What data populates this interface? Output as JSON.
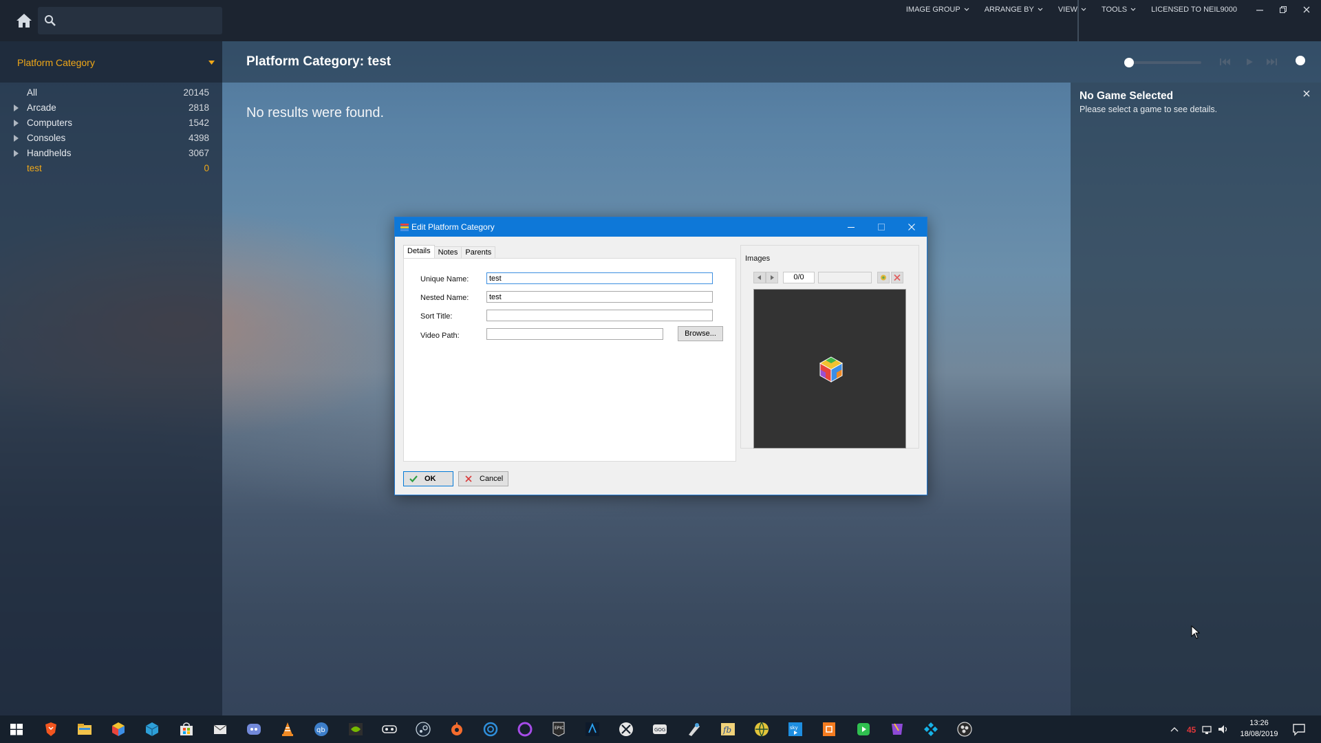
{
  "search": {
    "placeholder": ""
  },
  "top_menu": {
    "image_group": "IMAGE GROUP",
    "arrange_by": "ARRANGE BY",
    "view": "VIEW",
    "tools": "TOOLS",
    "license": "LICENSED TO NEIL9000"
  },
  "sidebar": {
    "title": "Platform Category",
    "items": [
      {
        "label": "All",
        "count": "20145",
        "expandable": false
      },
      {
        "label": "Arcade",
        "count": "2818",
        "expandable": true
      },
      {
        "label": "Computers",
        "count": "1542",
        "expandable": true
      },
      {
        "label": "Consoles",
        "count": "4398",
        "expandable": true
      },
      {
        "label": "Handhelds",
        "count": "3067",
        "expandable": true
      },
      {
        "label": "test",
        "count": "0",
        "expandable": false,
        "active": true
      }
    ]
  },
  "main": {
    "title": "Platform Category: test",
    "empty_message": "No results were found."
  },
  "details_panel": {
    "title": "No Game Selected",
    "subtitle": "Please select a game to see details."
  },
  "dialog": {
    "title": "Edit Platform Category",
    "tabs": [
      {
        "label": "Details",
        "active": true
      },
      {
        "label": "Notes",
        "active": false
      },
      {
        "label": "Parents",
        "active": false
      }
    ],
    "fields": {
      "unique_name_label": "Unique Name:",
      "unique_name_value": "test",
      "nested_name_label": "Nested Name:",
      "nested_name_value": "test",
      "sort_title_label": "Sort Title:",
      "sort_title_value": "",
      "video_path_label": "Video Path:",
      "video_path_value": ""
    },
    "browse_label": "Browse...",
    "images_label": "Images",
    "image_counter": "0/0",
    "ok_label": "OK",
    "cancel_label": "Cancel"
  },
  "taskbar": {
    "badge_count": "45",
    "time": "13:26",
    "date": "18/08/2019"
  },
  "colors": {
    "accent_orange": "#f0a818",
    "dialog_titlebar": "#0e78d8",
    "topbar": "#1c2430",
    "taskbar": "#16202c"
  }
}
